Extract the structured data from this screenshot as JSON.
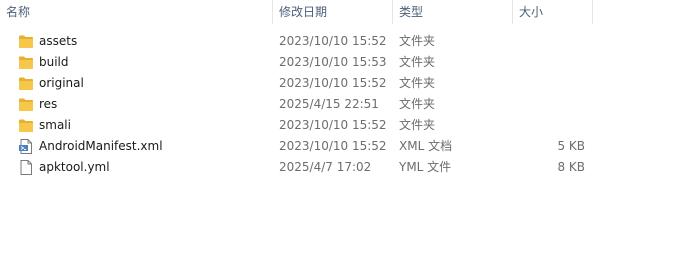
{
  "columns": {
    "name": "名称",
    "date": "修改日期",
    "type": "类型",
    "size": "大小"
  },
  "sort_indicator": "^",
  "files": [
    {
      "name": "assets",
      "date": "2023/10/10 15:52",
      "type": "文件夹",
      "size": "",
      "icon": "folder-icon"
    },
    {
      "name": "build",
      "date": "2023/10/10 15:53",
      "type": "文件夹",
      "size": "",
      "icon": "folder-icon"
    },
    {
      "name": "original",
      "date": "2023/10/10 15:52",
      "type": "文件夹",
      "size": "",
      "icon": "folder-icon"
    },
    {
      "name": "res",
      "date": "2025/4/15 22:51",
      "type": "文件夹",
      "size": "",
      "icon": "folder-icon"
    },
    {
      "name": "smali",
      "date": "2023/10/10 15:52",
      "type": "文件夹",
      "size": "",
      "icon": "folder-icon"
    },
    {
      "name": "AndroidManifest.xml",
      "date": "2023/10/10 15:52",
      "type": "XML 文档",
      "size": "5 KB",
      "icon": "xml-file-icon"
    },
    {
      "name": "apktool.yml",
      "date": "2025/4/7 17:02",
      "type": "YML 文件",
      "size": "8 KB",
      "icon": "file-icon"
    }
  ],
  "colors": {
    "folder": "#f5c84c",
    "folder_tab": "#e9b02f",
    "header_text": "#4c607a",
    "secondary_text": "#6d6d6d"
  }
}
